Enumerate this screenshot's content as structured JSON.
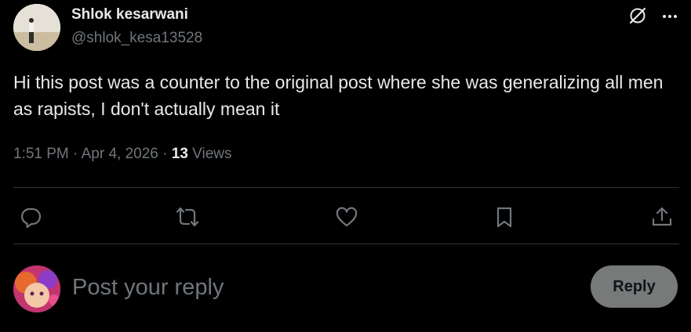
{
  "author": {
    "display_name": "Shlok kesarwani",
    "handle": "@shlok_kesa13528"
  },
  "post": {
    "text": "Hi this post was a counter to the original post where she was generalizing all men as rapists, I don't actually mean it",
    "time": "1:51 PM",
    "separator": "·",
    "date": "Apr 4, 2026",
    "views_count": "13",
    "views_label": "Views"
  },
  "header_icons": [
    "grok-icon",
    "more-icon"
  ],
  "actions": [
    "reply-icon",
    "repost-icon",
    "like-icon",
    "bookmark-icon",
    "share-icon"
  ],
  "composer": {
    "placeholder": "Post your reply",
    "button_label": "Reply"
  },
  "colors": {
    "background": "#000000",
    "primary_text": "#e7e9ea",
    "secondary_text": "#71767b",
    "divider": "#2f3336",
    "reply_button": "#787a7a"
  }
}
